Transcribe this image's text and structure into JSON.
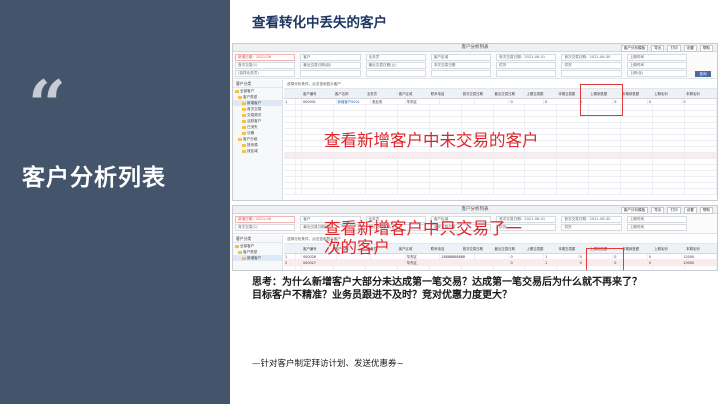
{
  "left": {
    "quote_mark": "“",
    "title": "客户分析列表"
  },
  "slide_title": "查看转化中丢失的客户",
  "screenshot1": {
    "app_title": "客户分析列表",
    "toolbar_buttons": [
      "客户分析模板",
      "导出",
      "打印",
      "设置",
      "帮助"
    ],
    "filters": [
      [
        "新增日期：2021-06",
        "客户",
        "业务员",
        "客户区域",
        "首次交易日期：2021-06-01",
        "首次交易日期：2021-06-30",
        "上期时间"
      ],
      [
        "首次交易(1)",
        "最近交易日期(起)",
        "最近交易日期(止)",
        "本次交易日期",
        "供货",
        "供货",
        "上期时间"
      ],
      [
        "(选择业务员)",
        "",
        "",
        "",
        "",
        "",
        "上期(含)"
      ]
    ],
    "query_label": "查询",
    "tree_header": "客户分类",
    "tree_items": [
      "全部客户",
      "客户类型",
      "新增客户",
      "首次交易",
      "交易频次",
      "活跃客户",
      "已流失",
      "沉睡",
      "客户分组",
      "按来源",
      "按区域"
    ],
    "table_note": "选择分析条件，点击查询显示客户",
    "columns": [
      "客户编号",
      "客户名称",
      "业务员",
      "客户区域",
      "联系电话",
      "首次交易日期",
      "最近交易日期",
      "上期交易额",
      "本期交易额",
      "上期销售额",
      "本期销售额",
      "上期毛利",
      "本期毛利"
    ],
    "rows": [
      [
        "1",
        "000001",
        "新增客户0001",
        "张业务",
        "华东区",
        "",
        "",
        "0",
        "0",
        "0",
        "0",
        "0",
        "0"
      ]
    ],
    "overlay_text": "查看新增客户中未交易的客户"
  },
  "screenshot2": {
    "app_title": "客户分析列表",
    "toolbar_buttons": [
      "客户分析模板",
      "导出",
      "打印",
      "设置",
      "帮助"
    ],
    "filters": [
      [
        "新增日期：2021-06",
        "客户",
        "业务员",
        "客户区域",
        "首次交易日期：2021-06-01",
        "首次交易日期：2021-06-30",
        "上期时间"
      ],
      [
        "首次交易(1)",
        "最近交易日期(起)",
        "最近交易日期(止)",
        "本次交易日期",
        "供货",
        "供货",
        "上期时间"
      ]
    ],
    "tree_header": "客户分类",
    "tree_items": [
      "全部客户",
      "客户类型",
      "新增客户"
    ],
    "table_note": "选择分析条件，点击查询显示客户",
    "columns": [
      "客户编号",
      "客户名称",
      "业务员",
      "客户区域",
      "联系电话",
      "首次交易日期",
      "最近交易日期",
      "上期交易额",
      "本期交易额",
      "上期销售额",
      "本期销售额",
      "上期毛利",
      "本期毛利"
    ],
    "rows": [
      [
        "1",
        "000026",
        "",
        "",
        "华东区",
        "18888888888",
        "",
        "0",
        "1",
        "0",
        "0",
        "0",
        "12000"
      ],
      [
        "2",
        "000027",
        "",
        "",
        "华东区",
        "",
        "",
        "0",
        "1",
        "0",
        "0",
        "0",
        "10000"
      ]
    ],
    "overlay_line1": "查看新增客户中只交易了一",
    "overlay_line2": "次的客户"
  },
  "think": {
    "line1": "思考：为什么新增客户大部分未达成第一笔交易？达成第一笔交易后为什么就不再来了？",
    "line2": "目标客户不精准？业务员跟进不及时？竞对优惠力度更大？"
  },
  "conclusion": "—针对客户制定拜访计划、发送优惠券~"
}
